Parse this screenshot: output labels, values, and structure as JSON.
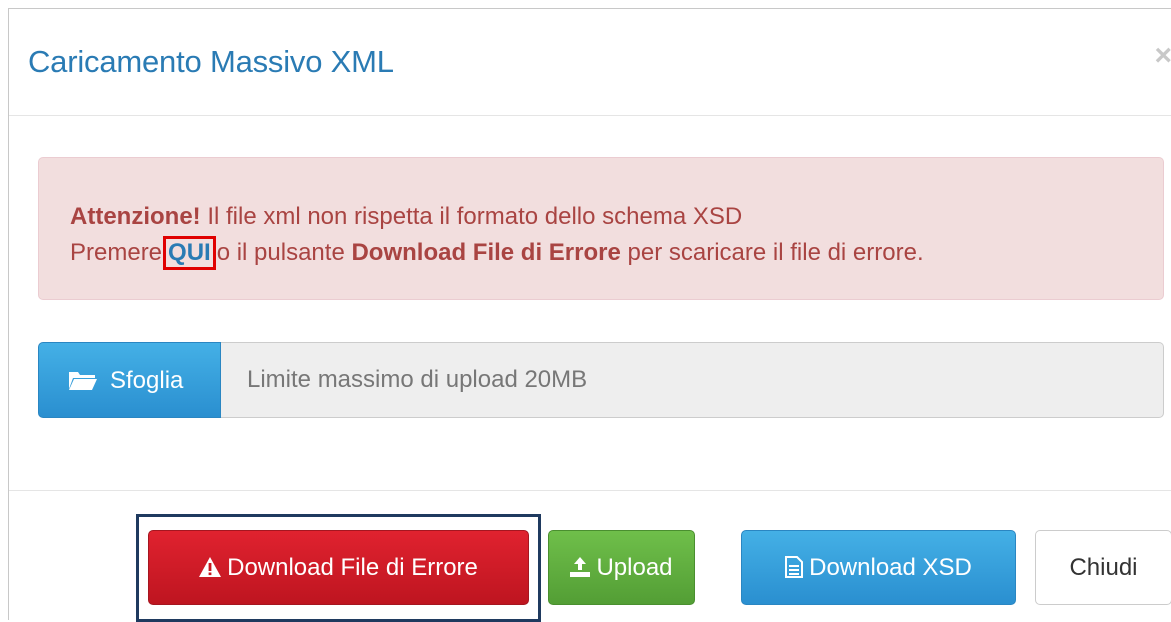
{
  "dialog": {
    "title": "Caricamento Massivo XML",
    "close_symbol": "×"
  },
  "alert": {
    "strong": "Attenzione!",
    "message": "Il file xml non rispetta il formato dello schema XSD",
    "line2_prefix": "Premere",
    "link_text": "QUI",
    "line2_middle": "o il pulsante",
    "button_ref": "Download File di Errore",
    "line2_suffix": "per scaricare il file di errore."
  },
  "file_upload": {
    "browse_label": "Sfoglia",
    "browse_icon": "folder-open-icon",
    "placeholder": "Limite massimo di upload 20MB"
  },
  "footer": {
    "error_button": "Download File di Errore",
    "error_icon": "warning-icon",
    "upload_button": "Upload",
    "upload_icon": "upload-icon",
    "xsd_button": "Download XSD",
    "xsd_icon": "file-text-icon",
    "close_button": "Chiudi"
  },
  "colors": {
    "title": "#2a7bb4",
    "alert_bg": "#f2dede",
    "alert_text": "#a94442",
    "danger": "#d9232d",
    "success": "#5cb038",
    "info": "#3aa0dd",
    "highlight_red": "#e00000",
    "highlight_navy": "#1f3a5f"
  }
}
